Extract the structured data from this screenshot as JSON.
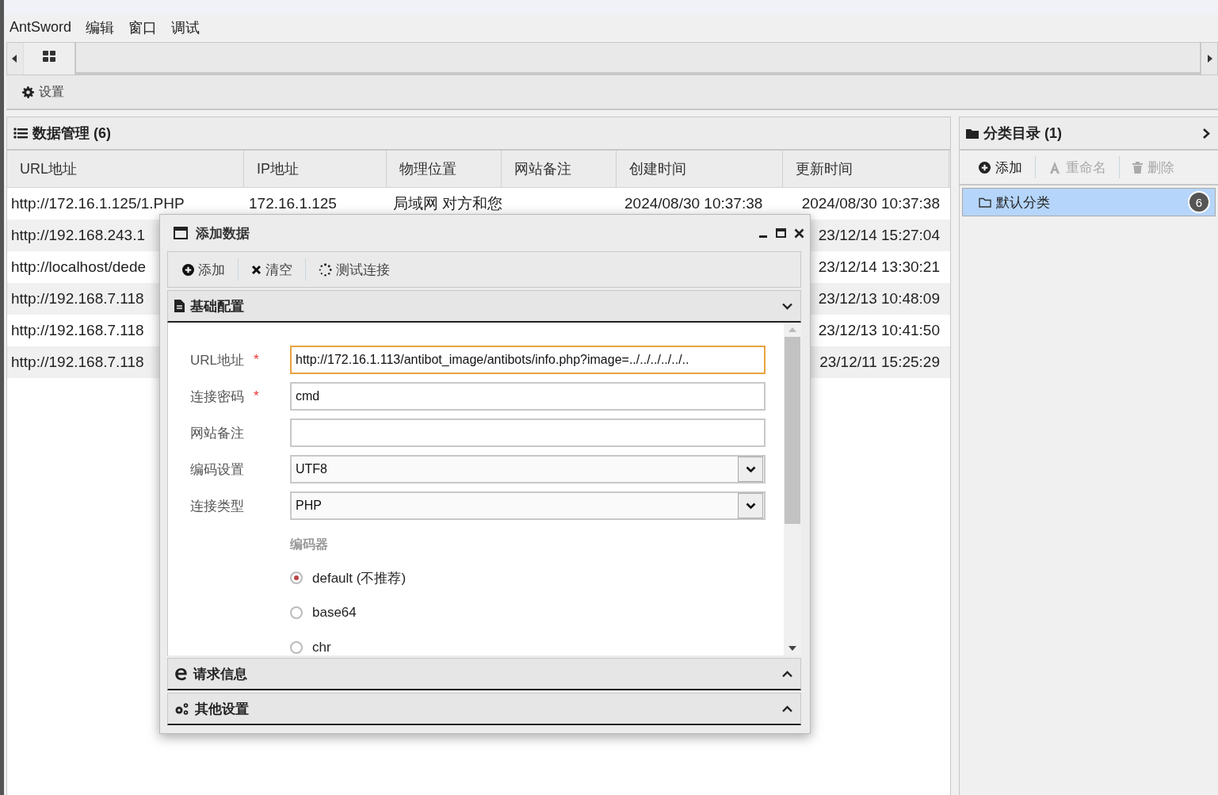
{
  "menu": [
    "AntSword",
    "编辑",
    "窗口",
    "调试"
  ],
  "toolbar": {
    "buttons": [
      {
        "label": "设置"
      }
    ]
  },
  "data_panel": {
    "title": "数据管理 (6)",
    "columns": [
      "URL地址",
      "IP地址",
      "物理位置",
      "网站备注",
      "创建时间",
      "更新时间"
    ],
    "rows": [
      {
        "first": "http://172.16.1.125/1.PHP",
        "middle": [
          "172.16.1.125",
          "局域网 对方和您"
        ],
        "created": "2024/08/30 10:37:38",
        "last": "2024/08/30 10:37:38"
      },
      {
        "first": "http://192.168.243.1",
        "last": "23/12/14 15:27:04"
      },
      {
        "first": "http://localhost/dede",
        "last": "23/12/14 13:30:21"
      },
      {
        "first": "http://192.168.7.118",
        "last": "23/12/13 10:48:09"
      },
      {
        "first": "http://192.168.7.118",
        "last": "23/12/13 10:41:50"
      },
      {
        "first": "http://192.168.7.118",
        "last": "23/12/11 15:25:29"
      }
    ]
  },
  "category_panel": {
    "title": "分类目录 (1)",
    "toolbar": [
      {
        "kind": "add",
        "label": "添加",
        "disabled": false
      },
      {
        "kind": "rename",
        "label": "重命名",
        "disabled": true
      },
      {
        "kind": "delete",
        "label": "删除",
        "disabled": true
      }
    ],
    "items": [
      {
        "label": "默认分类",
        "count": "6",
        "selected": true
      }
    ]
  },
  "dialog": {
    "title": "添加数据",
    "toolbar": [
      {
        "kind": "add",
        "label": "添加"
      },
      {
        "kind": "clear",
        "label": "清空"
      },
      {
        "kind": "test",
        "label": "测试连接"
      }
    ],
    "sections": [
      {
        "kind": "basic",
        "title": "基础配置",
        "expanded": true,
        "fields": [
          {
            "kind": "text",
            "label": "URL地址",
            "required_mark": "*",
            "focused": true,
            "value": "http://172.16.1.113/antibot_image/antibots/info.php?image=../../../../../.."
          },
          {
            "kind": "text",
            "label": "连接密码",
            "required_mark": "*",
            "focused": false,
            "value": "cmd"
          },
          {
            "kind": "text",
            "label": "网站备注",
            "focused": false
          },
          {
            "kind": "select",
            "label": "编码设置",
            "focused": false,
            "value": "UTF8"
          },
          {
            "kind": "select",
            "label": "连接类型",
            "focused": false,
            "value": "PHP"
          }
        ],
        "encoder": {
          "label": "编码器",
          "options": [
            {
              "label": "default (不推荐)",
              "selected": true
            },
            {
              "label": "base64",
              "selected": false
            },
            {
              "label": "chr",
              "selected": false
            }
          ]
        }
      },
      {
        "kind": "request",
        "title": "请求信息",
        "expanded": false
      },
      {
        "kind": "other",
        "title": "其他设置",
        "expanded": false
      }
    ]
  }
}
